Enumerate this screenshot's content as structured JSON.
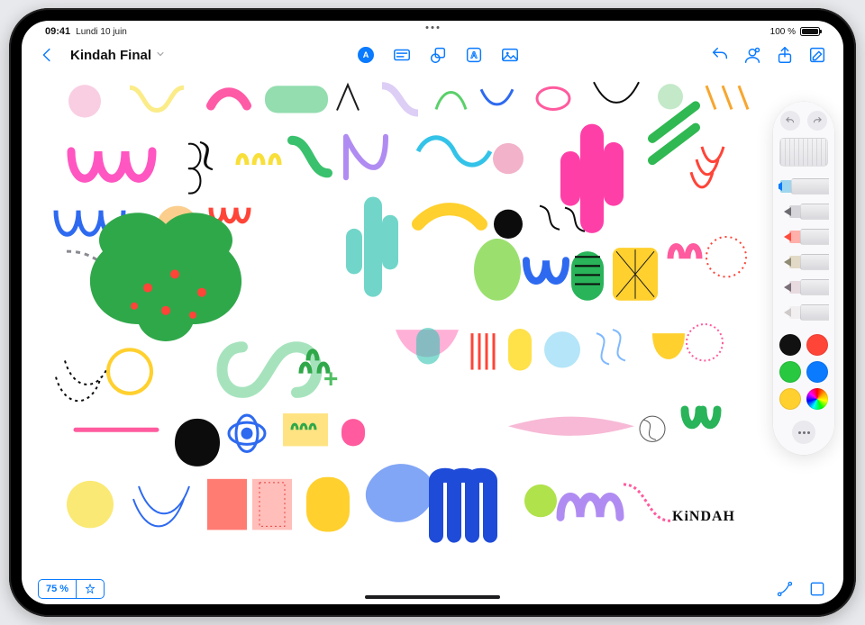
{
  "status": {
    "time": "09:41",
    "date": "Lundi 10 juin",
    "battery_label": "100 %"
  },
  "header": {
    "back_label": "",
    "document_title": "Kindah Final"
  },
  "center_tools": {
    "markup_label": "A",
    "textbox_label": "",
    "shapes_label": "",
    "text_style_label": "A",
    "media_label": ""
  },
  "right_tools": {
    "undo_label": "",
    "collaborate_label": "",
    "share_label": "",
    "compose_label": ""
  },
  "zoom": {
    "value": "75 %"
  },
  "signature": "KiNDAH",
  "palette": {
    "tools": [
      "pen",
      "brush",
      "marker",
      "pencil",
      "crayon",
      "eraser"
    ],
    "selected_tool": "pen",
    "colors": [
      "black",
      "red",
      "green",
      "blue",
      "yellow",
      "wheel"
    ],
    "selected_color": "black"
  }
}
